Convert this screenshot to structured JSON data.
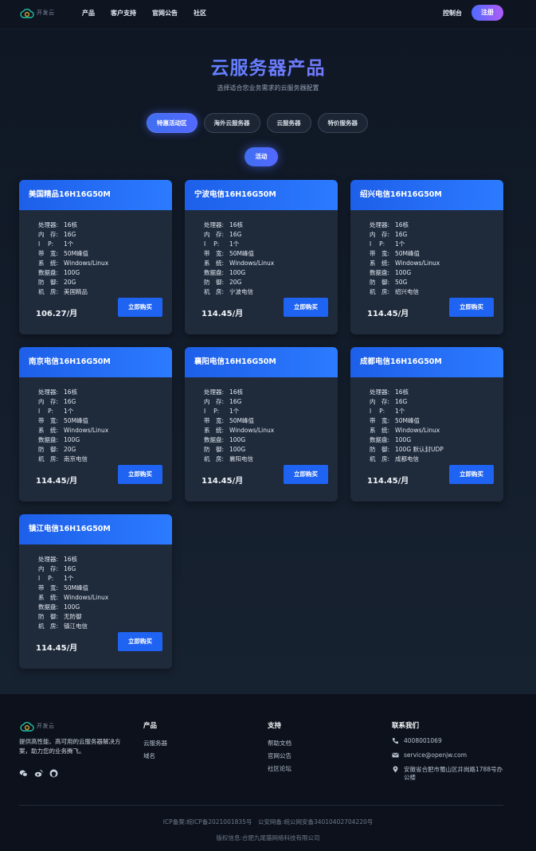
{
  "header": {
    "logo_text": "开发云",
    "nav": [
      "产品",
      "客户支持",
      "官网公告",
      "社区"
    ],
    "console": "控制台",
    "register": "注册"
  },
  "hero": {
    "title": "云服务器产品",
    "subtitle": "选择适合您业务需求的云服务器配置"
  },
  "tabs": [
    "特惠活动区",
    "海外云服务器",
    "云服务器",
    "特价服务器"
  ],
  "active_tab": "特惠活动区",
  "subtab": "活动",
  "spec_labels": [
    "处理器:",
    "内　存:",
    "I　 P:",
    "带　宽:",
    "系　统:",
    "数据盘:",
    "防　御:",
    "机　房:"
  ],
  "buy_label": "立即购买",
  "products": [
    {
      "name": "美国精品16H16G50M",
      "specs": [
        "16核",
        "16G",
        "1个",
        "50M峰值",
        "Windows/Linux",
        "100G",
        "20G",
        "美国精品"
      ],
      "price": "106.27/月"
    },
    {
      "name": "宁波电信16H16G50M",
      "specs": [
        "16核",
        "16G",
        "1个",
        "50M峰值",
        "Windows/Linux",
        "100G",
        "20G",
        "宁波电信"
      ],
      "price": "114.45/月"
    },
    {
      "name": "绍兴电信16H16G50M",
      "specs": [
        "16核",
        "16G",
        "1个",
        "50M峰值",
        "Windows/Linux",
        "100G",
        "50G",
        "绍兴电信"
      ],
      "price": "114.45/月"
    },
    {
      "name": "南京电信16H16G50M",
      "specs": [
        "16核",
        "16G",
        "1个",
        "50M峰值",
        "Windows/Linux",
        "100G",
        "20G",
        "南京电信"
      ],
      "price": "114.45/月"
    },
    {
      "name": "襄阳电信16H16G50M",
      "specs": [
        "16核",
        "16G",
        "1个",
        "50M峰值",
        "Windows/Linux",
        "100G",
        "100G",
        "襄阳电信"
      ],
      "price": "114.45/月"
    },
    {
      "name": "成都电信16H16G50M",
      "specs": [
        "16核",
        "16G",
        "1个",
        "50M峰值",
        "Windows/Linux",
        "100G",
        "100G 默认封UDP",
        "成都电信"
      ],
      "price": "114.45/月"
    },
    {
      "name": "镇江电信16H16G50M",
      "specs": [
        "16核",
        "16G",
        "1个",
        "50M峰值",
        "Windows/Linux",
        "100G",
        "无防御",
        "镇江电信"
      ],
      "price": "114.45/月"
    }
  ],
  "footer": {
    "logo_text": "开发云",
    "description": "提供高性能、高可用的云服务器解决方案，助力您的业务腾飞。",
    "social_icons": [
      "wechat-icon",
      "weibo-icon",
      "github-icon"
    ],
    "products_title": "产品",
    "products_links": [
      "云服务器",
      "域名"
    ],
    "support_title": "支持",
    "support_links": [
      "帮助文档",
      "官网公告",
      "社区论坛"
    ],
    "contact_title": "联系我们",
    "phone": "4008001069",
    "email": "service@openjw.com",
    "address": "安徽省合肥市蜀山区井岗路1788号办公楼",
    "icp": "ICP备案:皖ICP备2021001835号　公安网备:皖公网安备34010402704220号",
    "copyright": "版权信息:合肥九尾猫网络科技有限公司"
  },
  "colors": {
    "accent": "#1e63f2",
    "card_header": "#2c7bff",
    "background": "#0f1724"
  }
}
